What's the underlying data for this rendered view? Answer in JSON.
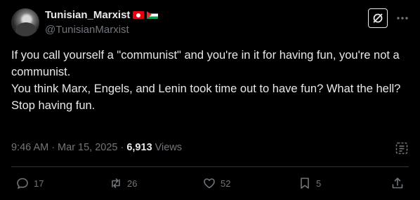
{
  "author": {
    "display_name": "Tunisian_Marxist",
    "handle": "@TunisianMarxist"
  },
  "tweet": {
    "lines": [
      "If you call yourself a \"communist\" and you're in it for having fun, you're not a communist.",
      "You think Marx, Engels, and Lenin took time out to have fun? What the hell?",
      "Stop having fun."
    ]
  },
  "meta": {
    "time": "9:46 AM",
    "separator1": "·",
    "date": "Mar 15, 2025",
    "separator2": "·",
    "views_count": "6,913",
    "views_label": "Views"
  },
  "actions": {
    "replies": "17",
    "reposts": "26",
    "likes": "52",
    "bookmarks": "5"
  },
  "icons": {
    "flags": [
      "tunisia-flag",
      "palestine-flag"
    ],
    "header": [
      "grok-icon",
      "more-icon"
    ],
    "actions": [
      "reply-icon",
      "repost-icon",
      "like-icon",
      "bookmark-icon",
      "share-icon"
    ],
    "meta": "analytics-icon"
  },
  "colors": {
    "background": "#000000",
    "text": "#e7e9ea",
    "muted": "#71767b",
    "divider": "#2f3336"
  }
}
